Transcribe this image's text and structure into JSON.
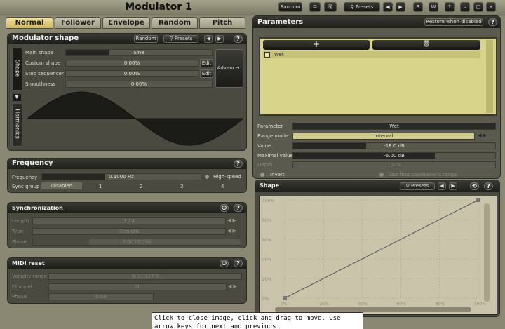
{
  "window": {
    "title": "Modulator 1",
    "random_label": "Random",
    "presets_label": "Presets",
    "r_label": "R",
    "w_label": "W",
    "help_label": "?"
  },
  "tabs": [
    {
      "label": "Normal",
      "active": true
    },
    {
      "label": "Follower",
      "active": false
    },
    {
      "label": "Envelope",
      "active": false
    },
    {
      "label": "Random",
      "active": false
    },
    {
      "label": "Pitch",
      "active": false
    }
  ],
  "modulator_shape": {
    "title": "Modulator shape",
    "random_label": "Random",
    "presets_label": "Presets",
    "side_tabs": [
      "Shape",
      "Harmonics"
    ],
    "rows": [
      {
        "label": "Main shape",
        "value": "Sine",
        "fill": 0.3
      },
      {
        "label": "Custom shape",
        "value": "0.00%",
        "fill": 0
      },
      {
        "label": "Step sequencer",
        "value": "0.00%",
        "fill": 0
      },
      {
        "label": "Smoothness",
        "value": "0.00%",
        "fill": 0
      }
    ],
    "edit_label": "Edit",
    "advanced_label": "Advanced"
  },
  "frequency": {
    "title": "Frequency",
    "freq_label": "Frequency",
    "freq_value": "0.1000 Hz",
    "freq_fill": 0.4,
    "high_speed_label": "High-speed",
    "sync_label": "Sync group",
    "sync_options": [
      "Disabled",
      "1",
      "2",
      "3",
      "4"
    ]
  },
  "synchronization": {
    "title": "Synchronization",
    "rows": [
      {
        "label": "Length",
        "value": "1 / 4"
      },
      {
        "label": "Type",
        "value": "Straight"
      },
      {
        "label": "Phase",
        "value": "0.00 (0.0%)"
      }
    ]
  },
  "midi_reset": {
    "title": "MIDI reset",
    "rows": [
      {
        "label": "Velocity range",
        "value": "0.0 / 127.0"
      },
      {
        "label": "Channel",
        "value": "All"
      },
      {
        "label": "Phase",
        "value": "0.00"
      }
    ]
  },
  "parameters": {
    "title": "Parameters",
    "restore_label": "Restore when disabled",
    "add_glyph": "+",
    "items": [
      {
        "name": "Wet",
        "checked": false
      }
    ],
    "fields": [
      {
        "label": "Parameter",
        "value": "Wet",
        "fill": 0,
        "style": "dark"
      },
      {
        "label": "Range mode",
        "value": "Interval",
        "fill": 0,
        "style": "yellow"
      },
      {
        "label": "Value",
        "value": "-18.0 dB",
        "fill": 0.36,
        "style": "bar"
      },
      {
        "label": "Maximal value",
        "value": "-6.00 dB",
        "fill": 0.7,
        "style": "bar"
      },
      {
        "label": "Depth",
        "value": "100%",
        "fill": 0,
        "style": "dim"
      }
    ],
    "invert_label": "Invert",
    "use_first_label": "Use first parameter's range"
  },
  "shape": {
    "title": "Shape",
    "presets_label": "Presets",
    "y_ticks": [
      "100%",
      "80%",
      "60%",
      "40%",
      "20%",
      "0%"
    ],
    "x_ticks": [
      "0%",
      "20%",
      "40%",
      "60%",
      "80%",
      "100%"
    ]
  },
  "tooltip": {
    "line1": "Click to close image, click and drag to move. Use",
    "line2": "arrow keys for next and previous."
  },
  "colors": {
    "active_tab": "#e2cf7a",
    "list_bg": "#d8d48a",
    "graph_bg": "#c9c4aa"
  }
}
